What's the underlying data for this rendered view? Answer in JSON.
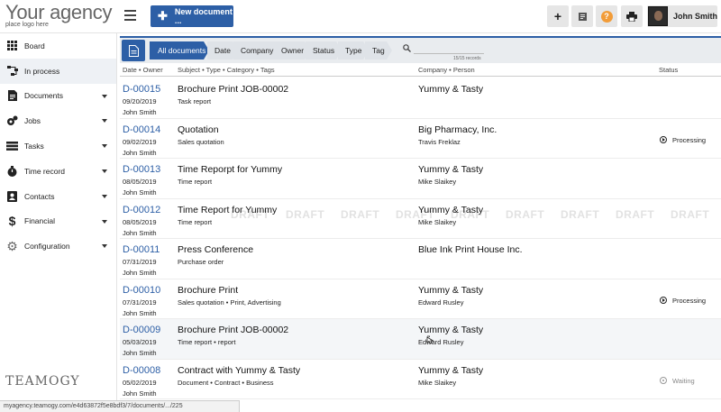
{
  "brand": {
    "name": "Your agency",
    "tagline": "place logo here",
    "footer_logo": "TEAMOGY"
  },
  "toolbar": {
    "new_document_label": "New document ...",
    "user_name": "John Smith",
    "help_label": "?"
  },
  "sidebar": {
    "items": [
      {
        "label": "Board",
        "icon": "grid-icon",
        "has_caret": false
      },
      {
        "label": "In process",
        "icon": "workflow-icon",
        "has_caret": false,
        "active": true
      },
      {
        "label": "Documents",
        "icon": "document-icon",
        "has_caret": true
      },
      {
        "label": "Jobs",
        "icon": "jobs-icon",
        "has_caret": true
      },
      {
        "label": "Tasks",
        "icon": "tasks-icon",
        "has_caret": true
      },
      {
        "label": "Time record",
        "icon": "stopwatch-icon",
        "has_caret": true
      },
      {
        "label": "Contacts",
        "icon": "contacts-icon",
        "has_caret": true
      },
      {
        "label": "Financial",
        "icon": "dollar-icon",
        "has_caret": true
      },
      {
        "label": "Configuration",
        "icon": "gear-icon",
        "has_caret": true
      }
    ]
  },
  "filters": {
    "crumbs": [
      "All documents",
      "Date",
      "Company",
      "Owner",
      "Status",
      "Type",
      "Tag"
    ],
    "records": "15/15 records"
  },
  "table": {
    "headers": {
      "col1": "Date • Owner",
      "col2": "Subject • Type • Category • Tags",
      "col3": "Company • Person",
      "col4": "Status"
    },
    "rows": [
      {
        "id": "D-00015",
        "date": "09/20/2019",
        "owner": "John Smith",
        "subject": "Brochure Print JOB-00002",
        "type": "Task report",
        "company": "Yummy & Tasty",
        "person": "",
        "status": ""
      },
      {
        "id": "D-00014",
        "date": "09/02/2019",
        "owner": "John Smith",
        "subject": "Quotation",
        "type": "Sales quotation",
        "company": "Big Pharmacy, Inc.",
        "person": "Travis Freklaz",
        "status": "Processing"
      },
      {
        "id": "D-00013",
        "date": "08/05/2019",
        "owner": "John Smith",
        "subject": "Time Reporpt for Yummy",
        "type": "Time report",
        "company": "Yummy & Tasty",
        "person": "Mike Slaikey",
        "status": ""
      },
      {
        "id": "D-00012",
        "date": "08/05/2019",
        "owner": "John Smith",
        "subject": "Time Report for Yummy",
        "type": "Time report",
        "company": "Yummy & Tasty",
        "person": "Mike Slaikey",
        "status": "",
        "draft": true
      },
      {
        "id": "D-00011",
        "date": "07/31/2019",
        "owner": "John Smith",
        "subject": "Press Conference",
        "type": "Purchase order",
        "company": "Blue Ink Print House Inc.",
        "person": "",
        "status": ""
      },
      {
        "id": "D-00010",
        "date": "07/31/2019",
        "owner": "John Smith",
        "subject": "Brochure Print",
        "type": "Sales quotation • Print, Advertising",
        "company": "Yummy & Tasty",
        "person": "Edward Rusley",
        "status": "Processing"
      },
      {
        "id": "D-00009",
        "date": "05/03/2019",
        "owner": "John Smith",
        "subject": "Brochure Print JOB-00002",
        "type": "Time report • report",
        "company": "Yummy & Tasty",
        "person": "Edward Rusley",
        "status": ""
      },
      {
        "id": "D-00008",
        "date": "05/02/2019",
        "owner": "John Smith",
        "subject": "Contract with Yummy & Tasty",
        "type": "Document • Contract • Business",
        "company": "Yummy & Tasty",
        "person": "Mike Slaikey",
        "status": "Waiting"
      }
    ],
    "draft_label": "DRAFT"
  },
  "statusbar": {
    "url": "myagency.teamogy.com/e4d63872f5e8bdf3/7/documents/.../225"
  }
}
